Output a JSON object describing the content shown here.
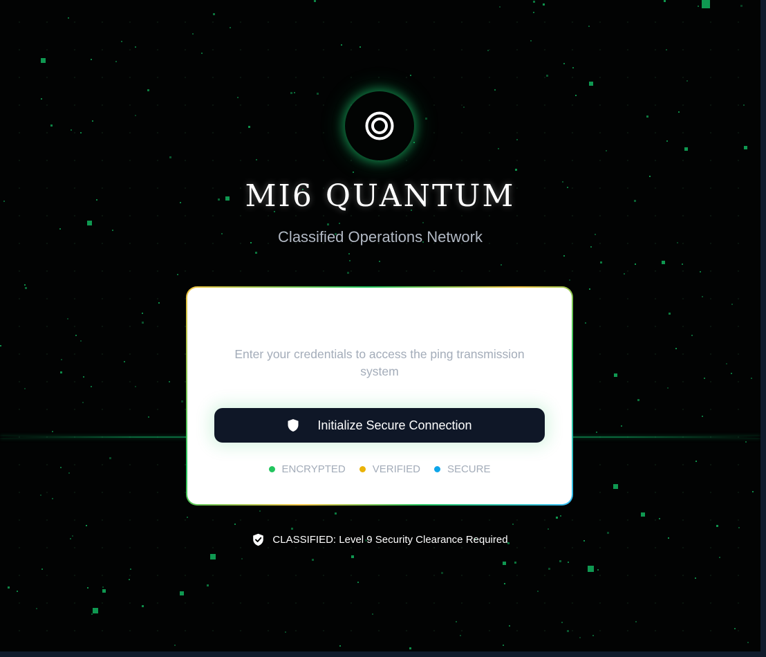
{
  "app": {
    "title": "MI6 QUANTUM",
    "subtitle": "Classified Operations Network",
    "logo_icon": "target-icon"
  },
  "login_card": {
    "description": "Enter your credentials to access the ping transmission system",
    "connect_button": {
      "label": "Initialize Secure Connection",
      "icon": "shield-icon"
    },
    "status_indicators": [
      {
        "label": "ENCRYPTED",
        "color": "#22c55e"
      },
      {
        "label": "VERIFIED",
        "color": "#eab308"
      },
      {
        "label": "SECURE",
        "color": "#0ea5e9"
      }
    ]
  },
  "footer": {
    "notice": "CLASSIFIED: Level 9 Security Clearance Required",
    "icon": "shield-check-icon"
  },
  "theme": {
    "background": "#020303",
    "accent": "#22c55e",
    "button_bg": "#0f1727",
    "card_bg": "#ffffff"
  }
}
